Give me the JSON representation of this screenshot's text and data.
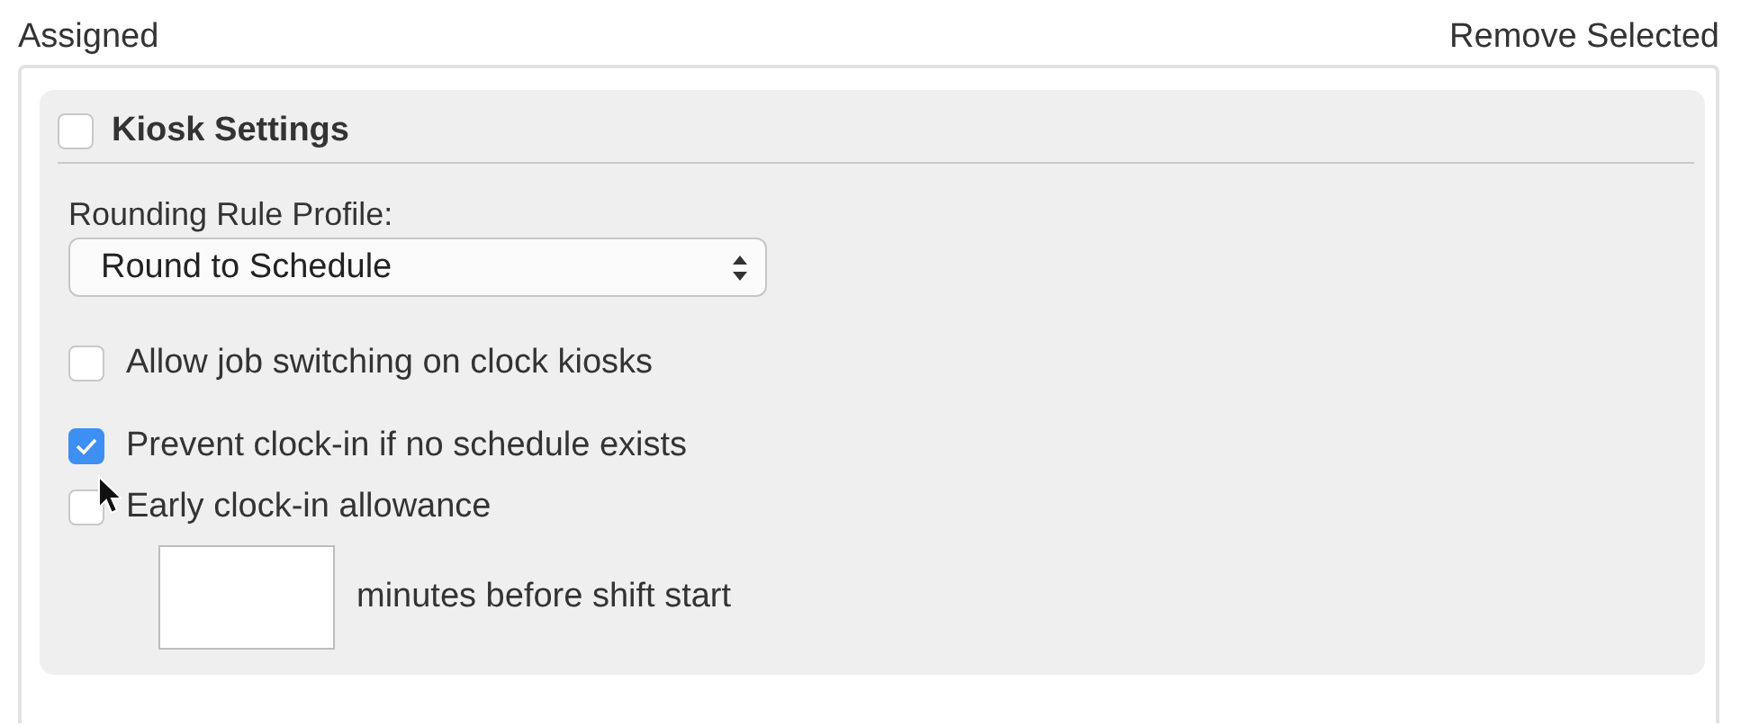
{
  "header": {
    "title": "Assigned",
    "action": "Remove Selected"
  },
  "section": {
    "title": "Kiosk Settings",
    "checked": false,
    "rounding": {
      "label": "Rounding Rule Profile:",
      "value": "Round to Schedule"
    },
    "options": [
      {
        "label": "Allow job switching on clock kiosks",
        "checked": false
      },
      {
        "label": "Prevent clock-in if no schedule exists",
        "checked": true
      },
      {
        "label": "Early clock-in allowance",
        "checked": false
      }
    ],
    "allowance": {
      "suffix": "minutes before shift start"
    }
  }
}
